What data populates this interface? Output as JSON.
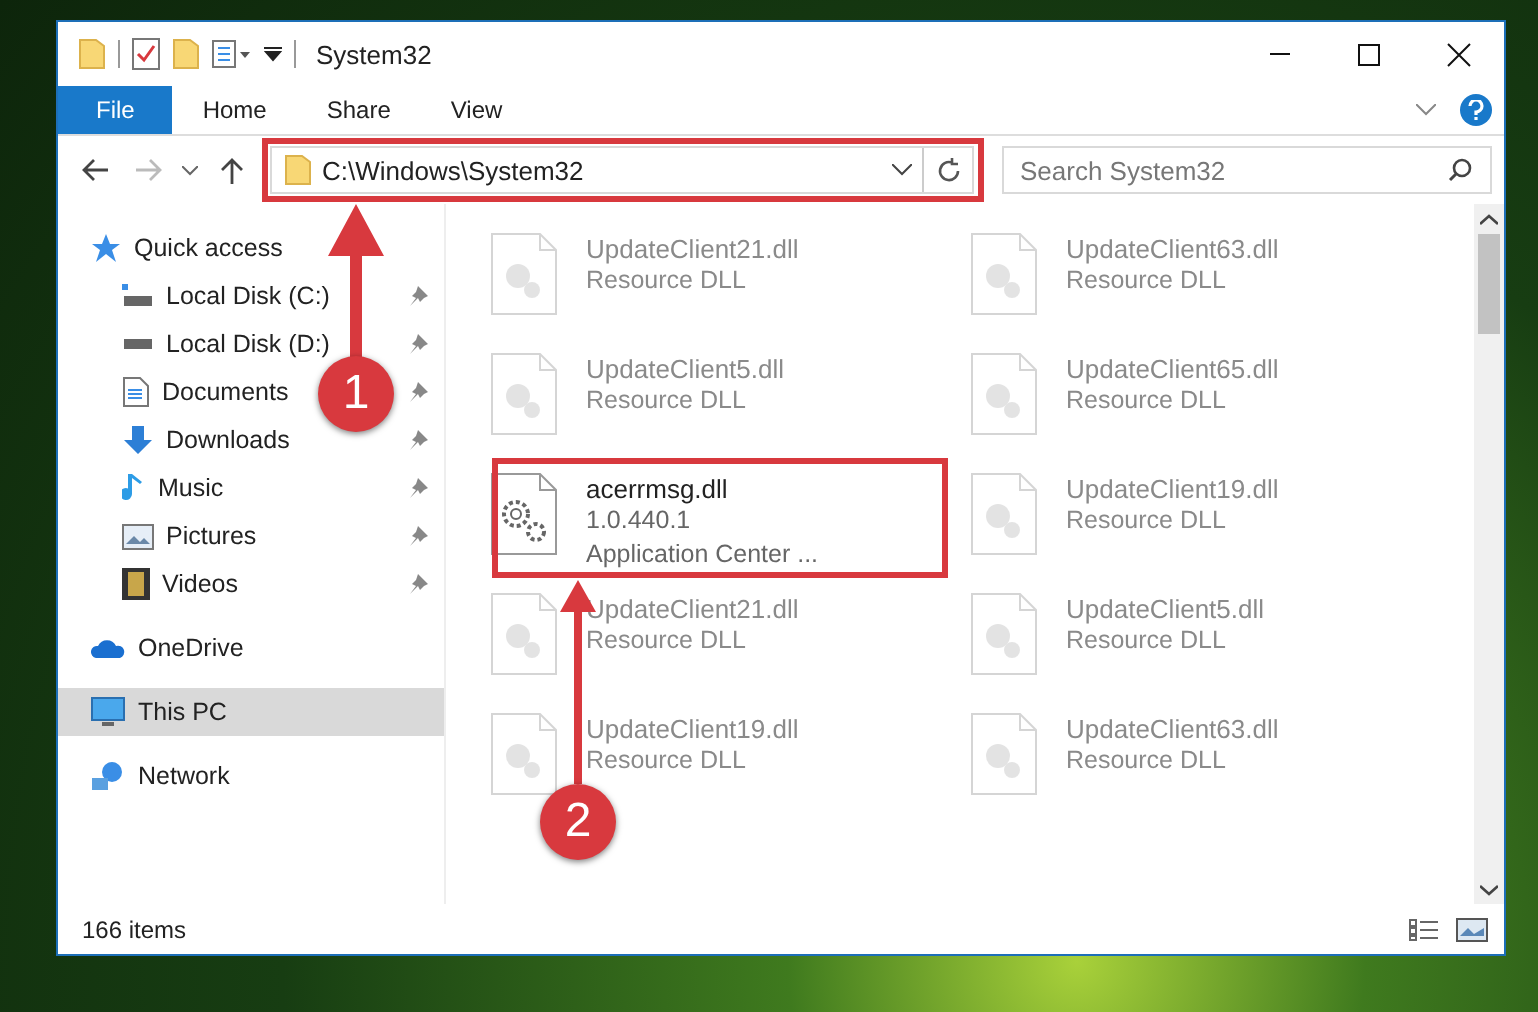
{
  "window": {
    "title": "System32"
  },
  "ribbon_tabs": [
    {
      "label": "File",
      "selected": true
    },
    {
      "label": "Home",
      "selected": false
    },
    {
      "label": "Share",
      "selected": false
    },
    {
      "label": "View",
      "selected": false
    }
  ],
  "address_bar": {
    "path": "C:\\Windows\\System32"
  },
  "search": {
    "placeholder": "Search System32"
  },
  "sidebar": {
    "items": [
      {
        "label": "Quick access",
        "selected": false,
        "children": [
          {
            "label": "Local Disk (C:)",
            "pinned": true
          },
          {
            "label": "Local Disk (D:)",
            "pinned": true
          },
          {
            "label": "Documents",
            "pinned": true
          },
          {
            "label": "Downloads",
            "pinned": true
          },
          {
            "label": "Music",
            "pinned": true
          },
          {
            "label": "Pictures",
            "pinned": true
          },
          {
            "label": "Videos",
            "pinned": true
          }
        ]
      },
      {
        "label": "OneDrive",
        "selected": false
      },
      {
        "label": "This PC",
        "selected": true
      },
      {
        "label": "Network",
        "selected": false
      }
    ]
  },
  "files": [
    {
      "name": "UpdateClient21.dll",
      "description": "Resource DLL",
      "blurred": true
    },
    {
      "name": "UpdateClient63.dll",
      "description": "Resource DLL",
      "blurred": true
    },
    {
      "name": "UpdateClient5.dll",
      "description": "Resource DLL",
      "blurred": true
    },
    {
      "name": "UpdateClient65.dll",
      "description": "Resource DLL",
      "blurred": true
    },
    {
      "name": "acerrmsg.dll",
      "version": "1.0.440.1",
      "description": "Application Center ...",
      "blurred": false
    },
    {
      "name": "UpdateClient19.dll",
      "description": "Resource DLL",
      "blurred": true
    },
    {
      "name": "UpdateClient21.dll",
      "description": "Resource DLL",
      "blurred": true
    },
    {
      "name": "UpdateClient5.dll",
      "description": "Resource DLL",
      "blurred": true
    },
    {
      "name": "UpdateClient19.dll",
      "description": "Resource DLL",
      "blurred": true
    },
    {
      "name": "UpdateClient63.dll",
      "description": "Resource DLL",
      "blurred": true
    }
  ],
  "status_bar": {
    "count": "166 items"
  },
  "annotations": [
    {
      "number": "1"
    },
    {
      "number": "2"
    }
  ]
}
